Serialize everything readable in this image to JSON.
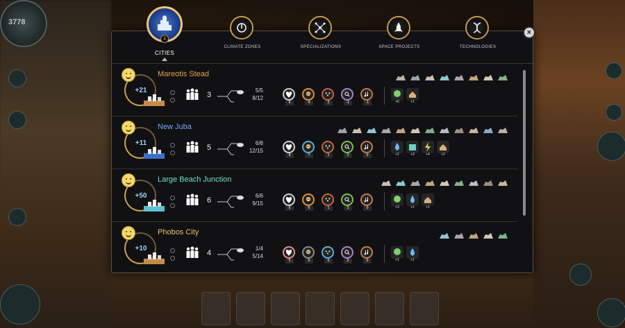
{
  "hud": {
    "population": "3778"
  },
  "tabs": [
    {
      "label": "CITIES",
      "active": true,
      "badge": "1"
    },
    {
      "label": "CLIMATE ZONES",
      "active": false
    },
    {
      "label": "SPECIALIZATIONS",
      "active": false
    },
    {
      "label": "SPACE PROJECTS",
      "active": false
    },
    {
      "label": "TECHNOLOGIES",
      "active": false
    }
  ],
  "close_label": "×",
  "cities": [
    {
      "name": "Mareotis Stead",
      "name_color": "#e9a04c",
      "score": "+21",
      "population": "3",
      "slots": "5/5",
      "housing": "8/12",
      "resources": [
        {
          "icon": "heart",
          "level": "6",
          "color": "#cfcfcf"
        },
        {
          "icon": "skull",
          "level": "4",
          "color": "#e0913a"
        },
        {
          "icon": "dots",
          "level": "2",
          "color": "#c9643a"
        },
        {
          "icon": "key",
          "level": "-1",
          "color": "#b07fd0"
        },
        {
          "icon": "music",
          "level": "-1",
          "color": "#c67b4a"
        }
      ],
      "yields": [
        {
          "icon": "plant",
          "value": "+6",
          "color": "#7cd36c"
        },
        {
          "icon": "house",
          "value": "+1",
          "color": "#d6b07a"
        }
      ],
      "buildings": 8
    },
    {
      "name": "New Juba",
      "name_color": "#7aa4ff",
      "score": "+11",
      "population": "5",
      "slots": "6/8",
      "housing": "12/15",
      "resources": [
        {
          "icon": "heart",
          "level": "8",
          "color": "#cfcfcf"
        },
        {
          "icon": "skull",
          "level": "7",
          "color": "#5ab0d8"
        },
        {
          "icon": "dots",
          "level": "1",
          "color": "#c9643a"
        },
        {
          "icon": "key",
          "level": "2",
          "color": "#7dbe4c"
        },
        {
          "icon": "music",
          "level": "0",
          "color": "#c67b4a"
        }
      ],
      "yields": [
        {
          "icon": "drop",
          "value": "+2",
          "color": "#6fb7ff"
        },
        {
          "icon": "box",
          "value": "+3",
          "color": "#6fd0c0"
        },
        {
          "icon": "bolt",
          "value": "+4",
          "color": "#e9cf5c"
        },
        {
          "icon": "house",
          "value": "+2",
          "color": "#d6b07a"
        }
      ],
      "buildings": 12
    },
    {
      "name": "Large Beach Junction",
      "name_color": "#6fe0d0",
      "score": "+50",
      "population": "6",
      "slots": "6/6",
      "housing": "9/15",
      "resources": [
        {
          "icon": "heart",
          "level": "6",
          "color": "#cfcfcf"
        },
        {
          "icon": "skull",
          "level": "6",
          "color": "#e0913a"
        },
        {
          "icon": "dots",
          "level": "1",
          "color": "#c9643a"
        },
        {
          "icon": "key",
          "level": "2",
          "color": "#7dbe4c"
        },
        {
          "icon": "music",
          "level": "0",
          "color": "#c67b4a"
        }
      ],
      "yields": [
        {
          "icon": "plant",
          "value": "+3",
          "color": "#7cd36c"
        },
        {
          "icon": "drop",
          "value": "+1",
          "color": "#6fb7ff"
        },
        {
          "icon": "house",
          "value": "+1",
          "color": "#d6b07a"
        }
      ],
      "buildings": 9
    },
    {
      "name": "Phobos City",
      "name_color": "#e9c06c",
      "score": "+10",
      "population": "4",
      "slots": "1/4",
      "housing": "5/14",
      "resources": [
        {
          "icon": "heart",
          "level": "5",
          "color": "#e98a8a"
        },
        {
          "icon": "skull",
          "level": "0",
          "color": "#8a8a8a"
        },
        {
          "icon": "dots",
          "level": "0",
          "color": "#5ab0d8"
        },
        {
          "icon": "key",
          "level": "0",
          "color": "#b07fd0"
        },
        {
          "icon": "music",
          "level": "0",
          "color": "#c67b4a"
        }
      ],
      "yields": [
        {
          "icon": "plant",
          "value": "+1",
          "color": "#7cd36c"
        },
        {
          "icon": "drop",
          "value": "+1",
          "color": "#6fb7ff"
        }
      ],
      "buildings": 5
    }
  ]
}
